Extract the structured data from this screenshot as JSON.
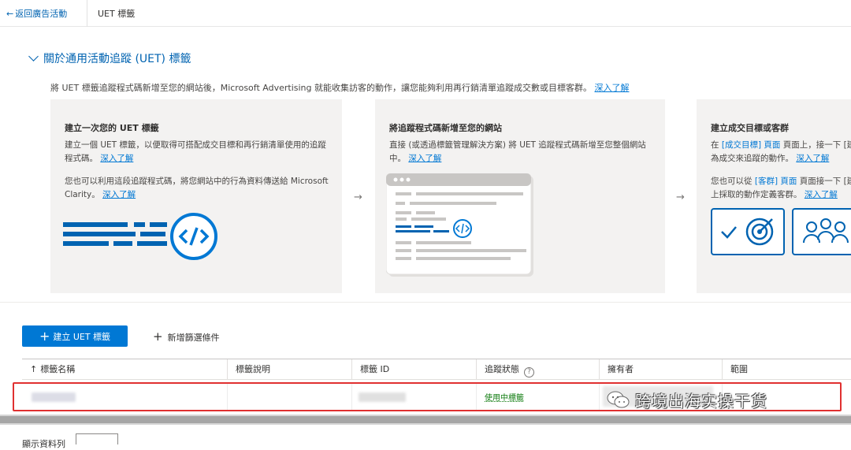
{
  "topbar": {
    "back_label": "返回廣告活動",
    "page_title": "UET 標籤"
  },
  "section": {
    "heading": "關於通用活動追蹤 (UET) 標籤",
    "intro": "將 UET 標籤追蹤程式碼新增至您的網站後，Microsoft Advertising 就能收集訪客的動作，讓您能夠利用再行銷清單追蹤成交數或目標客群。",
    "intro_link": "深入了解"
  },
  "cards": [
    {
      "title": "建立一次您的 UET 標籤",
      "text1": "建立一個 UET 標籤，以便取得可搭配成交目標和再行銷清單使用的追蹤程式碼。",
      "link1": "深入了解",
      "text2": "您也可以利用這段追蹤程式碼，將您網站中的行為資料傳送給 Microsoft Clarity。",
      "link2": "深入了解",
      "icon": "code-icon"
    },
    {
      "title": "將追蹤程式碼新增至您的網站",
      "text1": "直接 (或透過標籤管理解決方案) 將 UET 追蹤程式碼新增至您整個網站中。",
      "link1": "深入了解",
      "icon": "browser-code-icon"
    },
    {
      "title": "建立成交目標或客群",
      "text1a": "在",
      "text1b": "[成交目標]",
      "text1c": "頁面上，接一下 [建",
      "text1d": "為成交來追蹤的動作。",
      "link1": "深入了解",
      "text2a": "您也可以從",
      "text2b": "[客群]",
      "text2c": "頁面接一下 [建",
      "text2d": "上採取的動作定義客群。",
      "link2": "深入了解",
      "icons": [
        "check-icon",
        "target-icon",
        "audience-icon"
      ]
    }
  ],
  "toolbar": {
    "create_label": "建立 UET 標籤",
    "filter_label": "新增篩選條件"
  },
  "table": {
    "columns": [
      "標籤名稱",
      "標籤說明",
      "標籤 ID",
      "追蹤狀態",
      "擁有者",
      "範圍"
    ],
    "rows": [
      {
        "status": "使用中標籤"
      }
    ]
  },
  "watermark": "跨境出海实操干货",
  "footer": {
    "rows_label": "顯示資料列"
  },
  "colors": {
    "accent": "#0078d4",
    "link": "#0063b1",
    "active_status": "#107c10",
    "highlight": "#e03030"
  }
}
